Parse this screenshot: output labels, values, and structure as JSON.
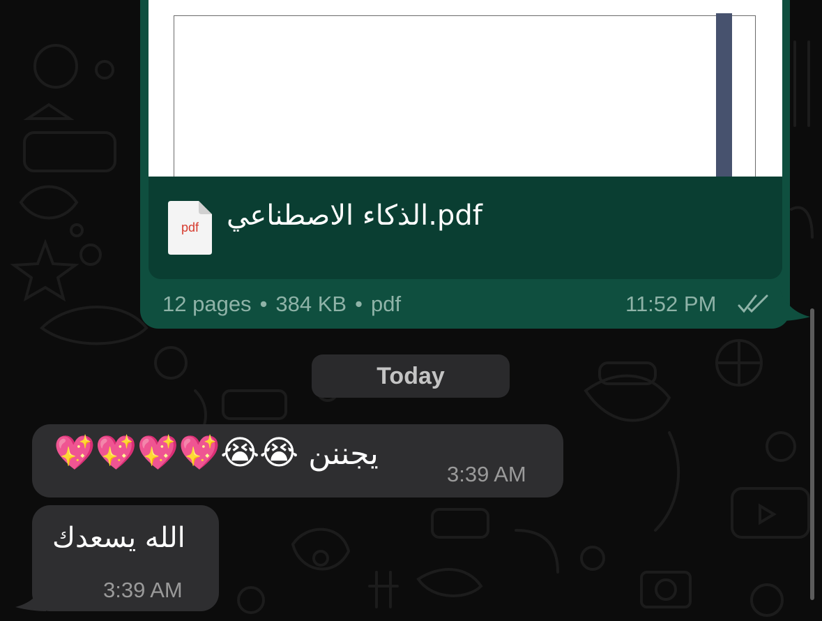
{
  "document_message": {
    "file_name": "الذكاء الاصطناعي.pdf",
    "file_type_icon": "pdf-file-icon",
    "icon_label": "pdf",
    "pages": "12 pages",
    "size": "384 KB",
    "type": "pdf",
    "separator": "•",
    "time": "11:52 PM",
    "status_icon": "double-check-icon"
  },
  "date_separator": "Today",
  "messages": [
    {
      "text": "يجننن",
      "emojis": "💖💖💖💖😭😭",
      "time": "3:39 AM"
    },
    {
      "text": "الله يسعدك",
      "time": "3:39 AM"
    }
  ],
  "colors": {
    "outgoing_bubble": "#0f4f3f",
    "incoming_bubble": "#2e2e30",
    "background": "#0c0c0c",
    "doc_sidebar": "#47526e"
  }
}
